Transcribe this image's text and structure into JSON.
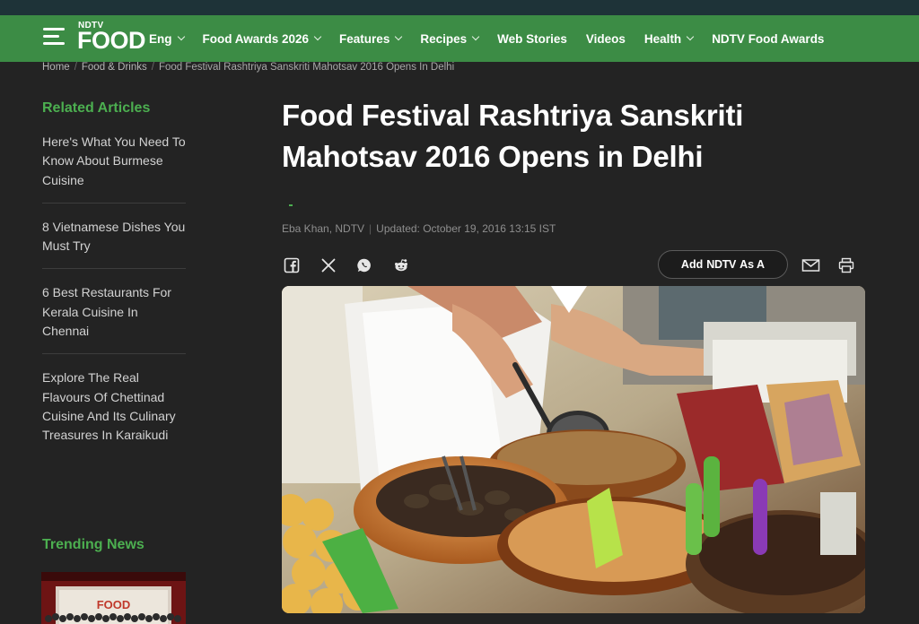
{
  "nav": {
    "logo_small": "NDTV",
    "logo_big": "FOOD",
    "items": [
      {
        "label": "Eng",
        "has_menu": true
      },
      {
        "label": "Food Awards 2026",
        "has_menu": true
      },
      {
        "label": "Features",
        "has_menu": true
      },
      {
        "label": "Recipes",
        "has_menu": true
      },
      {
        "label": "Web Stories",
        "has_menu": false
      },
      {
        "label": "Videos",
        "has_menu": false
      },
      {
        "label": "Health",
        "has_menu": true
      },
      {
        "label": "NDTV Food Awards",
        "has_menu": false
      }
    ]
  },
  "breadcrumb": {
    "home": "Home",
    "section": "Food & Drinks",
    "current": "Food Festival Rashtriya Sanskriti Mahotsav 2016 Opens In Delhi"
  },
  "sidebar": {
    "related_heading": "Related Articles",
    "related": [
      "Here's What You Need To Know About Burmese Cuisine",
      "8 Vietnamese Dishes You Must Try",
      "6 Best Restaurants For Kerala Cuisine In Chennai",
      "Explore The Real Flavours Of Chettinad Cuisine And Its Culinary Treasures In Karaikudi"
    ],
    "trending_heading": "Trending News",
    "trending_thumb_logo": "FOOD"
  },
  "article": {
    "headline": "Food Festival Rashtriya Sanskriti Mahotsav 2016 Opens in Delhi",
    "author": "Eba Khan, NDTV",
    "updated": "Updated: October 19, 2016 13:15 IST",
    "add_button": {
      "prefix": "Add",
      "brand": "NDTV",
      "suffix": "As A"
    },
    "share_icons": [
      "facebook-icon",
      "x-icon",
      "whatsapp-icon",
      "reddit-icon",
      "email-icon",
      "print-icon"
    ]
  },
  "colors": {
    "nav_bg": "#3c8c45",
    "accent_green": "#4caf50",
    "page_bg": "#232323"
  }
}
